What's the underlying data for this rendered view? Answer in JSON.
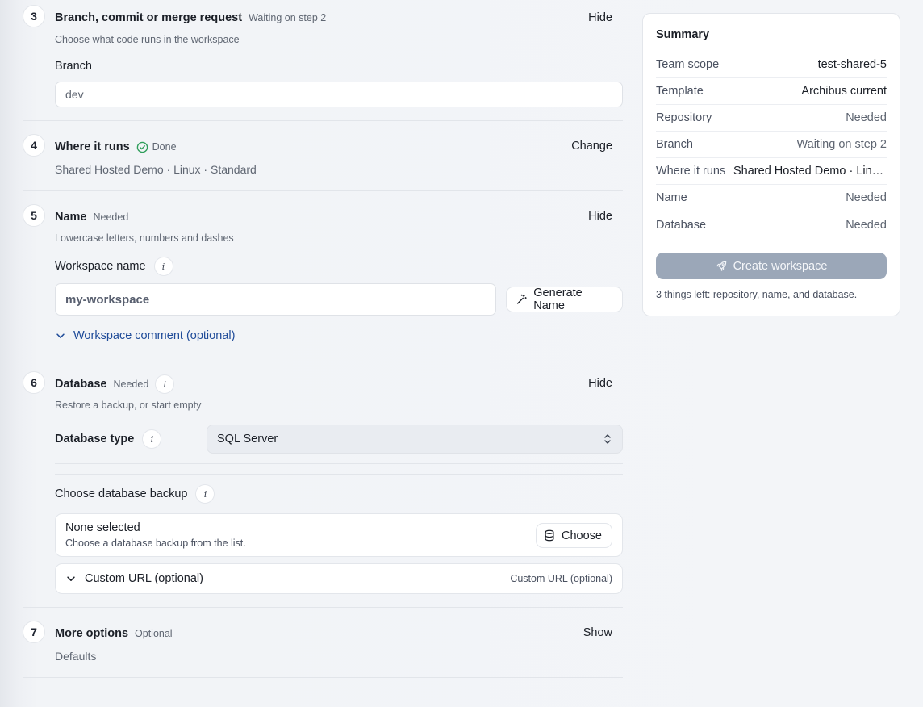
{
  "steps": {
    "s3": {
      "number": "3",
      "title": "Branch, commit or merge request",
      "status": "Waiting on step 2",
      "subtitle": "Choose what code runs in the workspace",
      "action": "Hide",
      "branch_label": "Branch",
      "branch_value": "dev"
    },
    "s4": {
      "number": "4",
      "title": "Where it runs",
      "status": "Done",
      "value": "Shared Hosted Demo · Linux · Standard",
      "action": "Change"
    },
    "s5": {
      "number": "5",
      "title": "Name",
      "status": "Needed",
      "subtitle": "Lowercase letters, numbers and dashes",
      "action": "Hide",
      "field_label": "Workspace name",
      "placeholder": "my-workspace",
      "generate_label": "Generate Name",
      "comment_toggle": "Workspace comment (optional)"
    },
    "s6": {
      "number": "6",
      "title": "Database",
      "status": "Needed",
      "subtitle": "Restore a backup, or start empty",
      "action": "Hide",
      "type_label": "Database type",
      "type_value": "SQL Server",
      "backup_label": "Choose database backup",
      "backup_title": "None selected",
      "backup_sub": "Choose a database backup from the list.",
      "choose_label": "Choose",
      "custom_url_label": "Custom URL (optional)",
      "custom_url_hint": "Custom URL (optional)"
    },
    "s7": {
      "number": "7",
      "title": "More options",
      "status": "Optional",
      "value": "Defaults",
      "action": "Show"
    }
  },
  "summary": {
    "title": "Summary",
    "rows": [
      {
        "key": "Team scope",
        "value": "test-shared-5"
      },
      {
        "key": "Template",
        "value": "Archibus current"
      },
      {
        "key": "Repository",
        "value": "Needed"
      },
      {
        "key": "Branch",
        "value": "Waiting on step 2"
      },
      {
        "key": "Where it runs",
        "value": "Shared Hosted Demo · Linux · Standard"
      },
      {
        "key": "Name",
        "value": "Needed"
      },
      {
        "key": "Database",
        "value": "Needed"
      }
    ],
    "create_label": "Create workspace",
    "left_note": "3 things left: repository, name, and database."
  },
  "colors": {
    "done_green": "#2f9e5b",
    "accent_blue": "#1f4b99",
    "disabled_button": "#9ba7b8"
  }
}
